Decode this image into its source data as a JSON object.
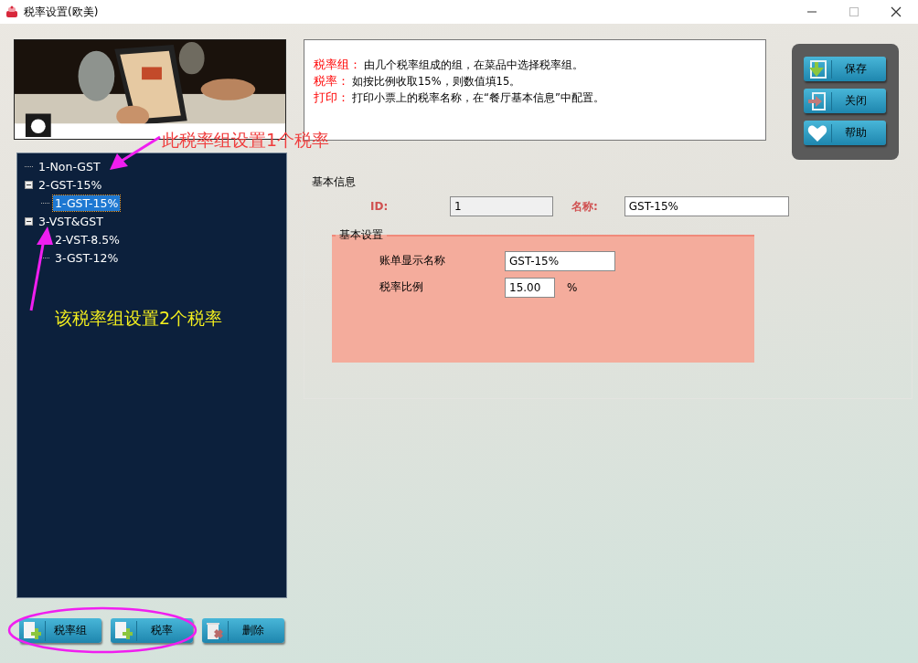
{
  "window": {
    "title": "税率设置(欧美)"
  },
  "tree": [
    {
      "label": "1-Non-GST",
      "selected": false
    },
    {
      "label": "2-GST-15%",
      "selected": false,
      "expanded": true,
      "children": [
        {
          "label": "1-GST-15%",
          "selected": true
        }
      ]
    },
    {
      "label": "3-VST&GST",
      "selected": false,
      "expanded": true,
      "children": [
        {
          "label": "2-VST-8.5%",
          "selected": false
        },
        {
          "label": "3-GST-12%",
          "selected": false
        }
      ]
    }
  ],
  "help_lines": [
    {
      "label": "税率组：",
      "text": "由几个税率组成的组，在菜品中选择税率组。"
    },
    {
      "label": "税率：",
      "text": "如按比例收取15%，则数值填15。"
    },
    {
      "label": "打印：",
      "text": "打印小票上的税率名称，在“餐厅基本信息”中配置。"
    }
  ],
  "side_buttons": [
    {
      "label": "保存",
      "kind": "save"
    },
    {
      "label": "关闭",
      "kind": "exit"
    },
    {
      "label": "帮助",
      "kind": "help"
    }
  ],
  "basic_info": {
    "legend": "基本信息",
    "id_label": "ID:",
    "id_value": "1",
    "name_label": "名称:",
    "name_value": "GST-15%",
    "settings": {
      "legend": "基本设置",
      "display_label": "账单显示名称",
      "display_value": "GST-15%",
      "rate_label": "税率比例",
      "rate_value": "15.00",
      "rate_unit": "%"
    }
  },
  "bottom_buttons": [
    {
      "label": "税率组",
      "kind": "add"
    },
    {
      "label": "税率",
      "kind": "add"
    },
    {
      "label": "删除",
      "kind": "delete"
    }
  ],
  "annotations": [
    {
      "text": "此税率组设置1个税率",
      "color": "#f03c3c"
    },
    {
      "text": "该税率组设置2个税率",
      "color": "#f5f01e"
    }
  ]
}
